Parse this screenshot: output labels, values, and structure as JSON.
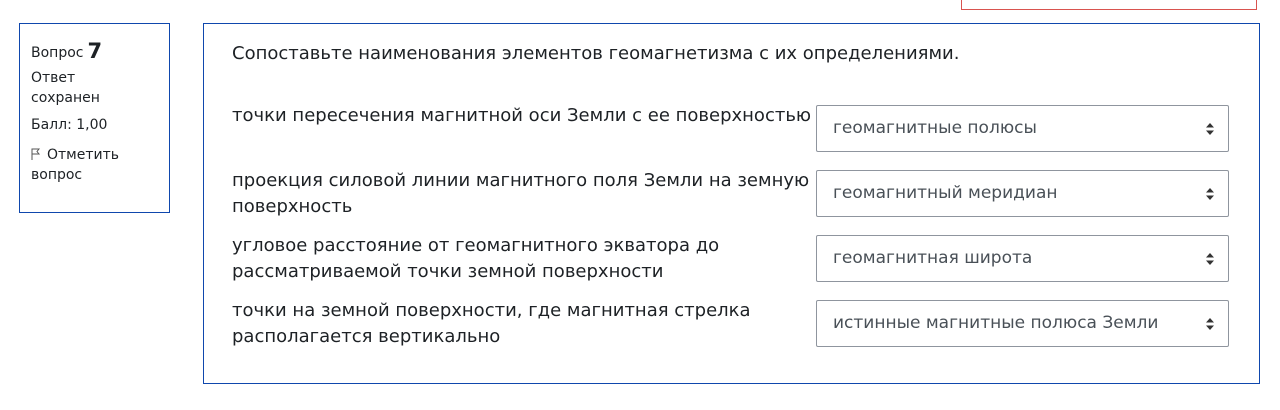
{
  "info": {
    "question_label": "Вопрос",
    "question_number": "7",
    "state": "Ответ сохранен",
    "grade": "Балл: 1,00",
    "flag_label": "Отметить вопрос"
  },
  "question": {
    "text": "Сопоставьте наименования элементов геомагнетизма с их определениями.",
    "rows": [
      {
        "stem": "точки пересечения магнитной оси Земли с ее поверхностью",
        "selected": "геомагнитные полюсы"
      },
      {
        "stem": "проекция силовой линии магнитного поля Земли на земную поверхность",
        "selected": "геомагнитный меридиан"
      },
      {
        "stem": "угловое расстояние от геомагнитного экватора до рассматриваемой точки земной поверхности",
        "selected": "геомагнитная широта"
      },
      {
        "stem": "точки на земной поверхности, где магнитная стрелка располагается вертикально",
        "selected": "истинные магнитные полюса Земли"
      }
    ]
  },
  "colors": {
    "border": "#0f47ad",
    "top_button_border": "#d9534f",
    "select_border": "#8f959e"
  },
  "icons": {
    "flag": "flag-outline-icon",
    "select": "sort-arrows-icon"
  }
}
